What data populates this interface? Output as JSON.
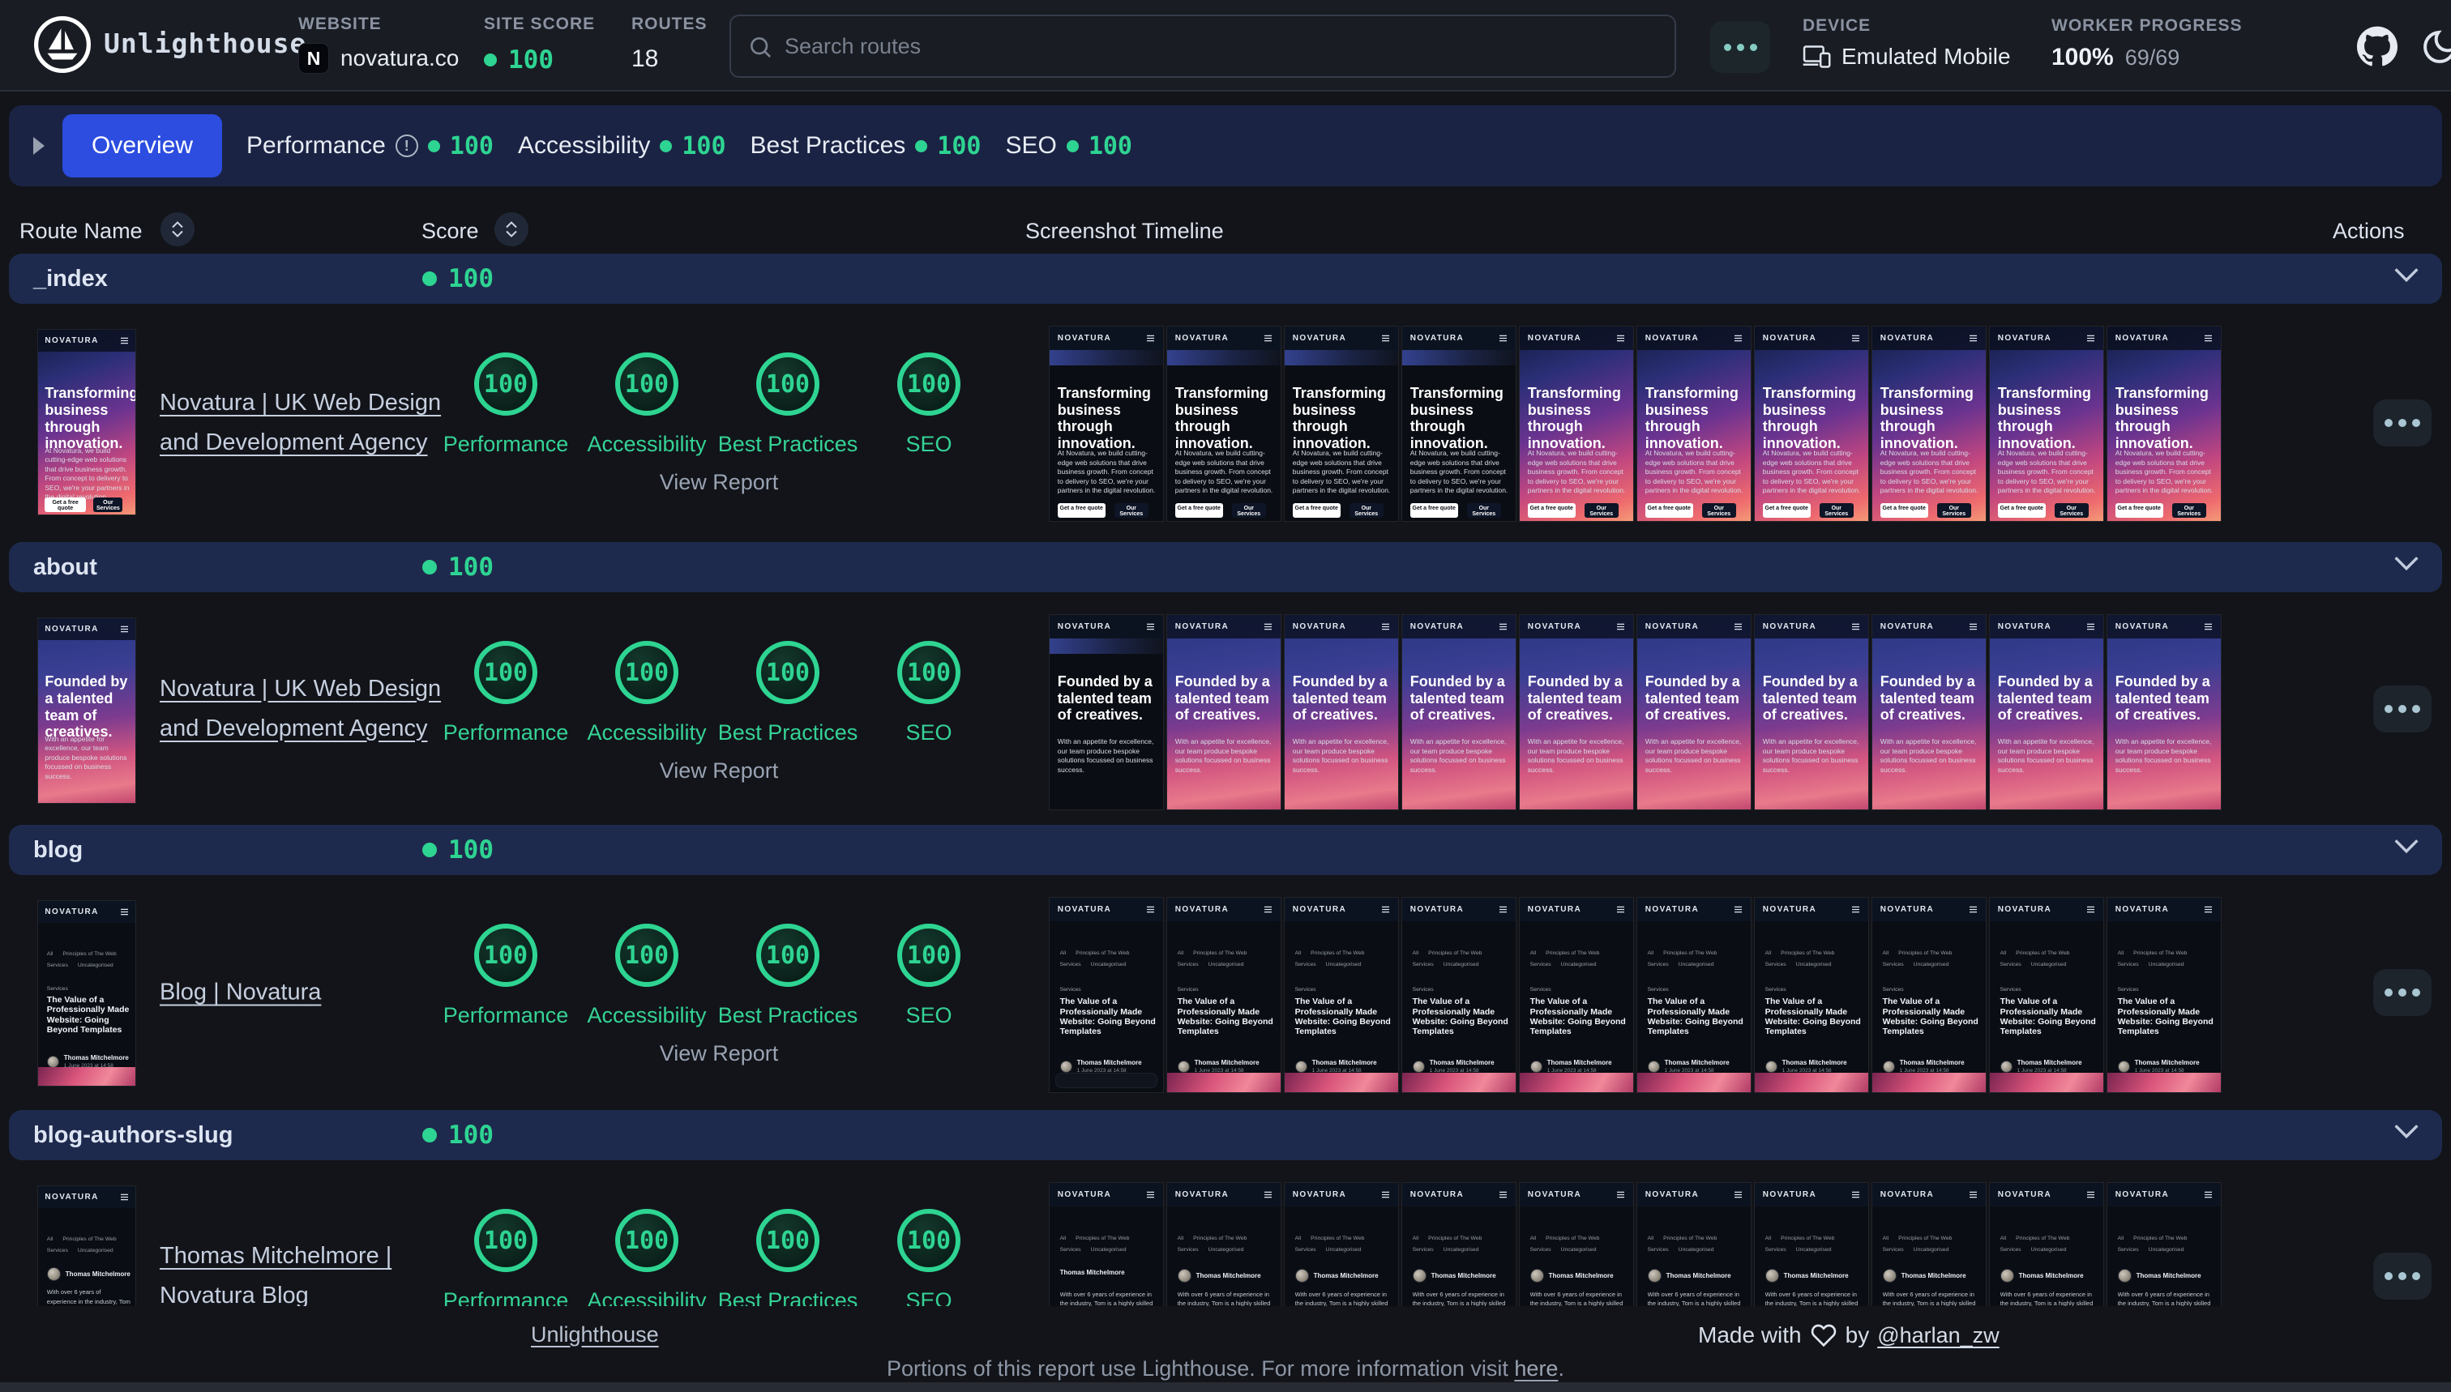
{
  "colors": {
    "background": "#121419",
    "header_bg": "#191c23",
    "panel_navy": "#1b2344",
    "row_navy": "#1e2a4d",
    "active_tab": "#2c4de0",
    "green": "#2ed492",
    "text_primary": "#e8edf5",
    "text_muted": "#8b93a2",
    "link": "#c6cfdf"
  },
  "header": {
    "app_title": "Unlighthouse",
    "website_label": "WEBSITE",
    "website_value": "novatura.co",
    "favicon_letter": "N",
    "site_score_label": "SITE SCORE",
    "site_score_value": "100",
    "routes_label": "ROUTES",
    "routes_value": "18",
    "search_placeholder": "Search routes",
    "device_label": "DEVICE",
    "device_value": "Emulated Mobile",
    "worker_label": "WORKER PROGRESS",
    "worker_percent": "100%",
    "worker_count": "69/69"
  },
  "tabs": [
    {
      "label": "Overview",
      "active": true
    },
    {
      "label": "Performance",
      "score": "100",
      "info": true
    },
    {
      "label": "Accessibility",
      "score": "100"
    },
    {
      "label": "Best Practices",
      "score": "100"
    },
    {
      "label": "SEO",
      "score": "100"
    }
  ],
  "table": {
    "col_route": "Route Name",
    "col_score": "Score",
    "col_timeline": "Screenshot Timeline",
    "col_actions": "Actions"
  },
  "metric_labels": [
    "Performance",
    "Accessibility",
    "Best Practices",
    "SEO"
  ],
  "view_report_label": "View Report",
  "routes": [
    {
      "name": "_index",
      "score": "100",
      "title": "Novatura | UK Web Design and Development Agency",
      "metric_values": [
        "100",
        "100",
        "100",
        "100"
      ],
      "main_variant": "gradient",
      "thumb": {
        "kind": "hero",
        "hero": "home",
        "brand": "NOVATURA",
        "heading": "Transforming business through innovation.",
        "body": "At Novatura, we build cutting-edge web solutions that drive business growth. From concept to delivery to SEO, we're your partners in the digital revolution.",
        "cta1": "Get a free quote",
        "cta2": "Our Services"
      },
      "timeline": [
        "plain",
        "plain",
        "plain",
        "plain",
        "gradient",
        "gradient",
        "gradient",
        "gradient",
        "gradient",
        "gradient"
      ]
    },
    {
      "name": "about",
      "score": "100",
      "title": "Novatura | UK Web Design and Development Agency",
      "metric_values": [
        "100",
        "100",
        "100",
        "100"
      ],
      "main_variant": "gradient",
      "thumb": {
        "kind": "hero",
        "hero": "about",
        "brand": "NOVATURA",
        "heading": "Founded by a talented team of creatives.",
        "body": "With an appetite for excellence, our team produce bespoke solutions focussed on business success."
      },
      "timeline": [
        "plain",
        "gradient",
        "gradient",
        "gradient",
        "gradient",
        "gradient",
        "gradient",
        "gradient",
        "gradient",
        "gradient"
      ]
    },
    {
      "name": "blog",
      "score": "100",
      "title": "Blog | Novatura",
      "metric_values": [
        "100",
        "100",
        "100",
        "100"
      ],
      "main_variant": "img",
      "thumb": {
        "kind": "blog",
        "brand": "NOVATURA",
        "nav1": "All",
        "nav2": "Principles of The Web",
        "nav3": "Services",
        "nav4": "Uncategorised",
        "tag": "Services",
        "heading": "The Value of a Professionally Made Website: Going Beyond Templates",
        "author": "Thomas Mitchelmore",
        "date": "1 June 2023 at 14:58"
      },
      "timeline": [
        "noimg",
        "img",
        "img",
        "img",
        "img",
        "img",
        "img",
        "img",
        "img",
        "img"
      ]
    },
    {
      "name": "blog-authors-slug",
      "score": "100",
      "title": "Thomas Mitchelmore | Novatura Blog",
      "metric_values": [
        "100",
        "100",
        "100",
        "100"
      ],
      "main_variant": "default",
      "thumb": {
        "kind": "author",
        "brand": "NOVATURA",
        "nav1": "All",
        "nav2": "Principles of The Web",
        "nav3": "Services",
        "nav4": "Uncategorised",
        "author": "Thomas Mitchelmore",
        "bio": "With over 6 years of experience in the industry, Tom is a highly skilled"
      },
      "timeline": [
        "noavatar",
        "default",
        "default",
        "default",
        "default",
        "default",
        "default",
        "default",
        "default",
        "default"
      ]
    }
  ],
  "footer": {
    "unlighthouse_link": "Unlighthouse",
    "made_with": "Made with",
    "by": "by",
    "author_link": "@harlan_zw",
    "note_before_link": "Portions of this report use Lighthouse. For more information visit",
    "note_link": "here",
    "note_end": "."
  }
}
